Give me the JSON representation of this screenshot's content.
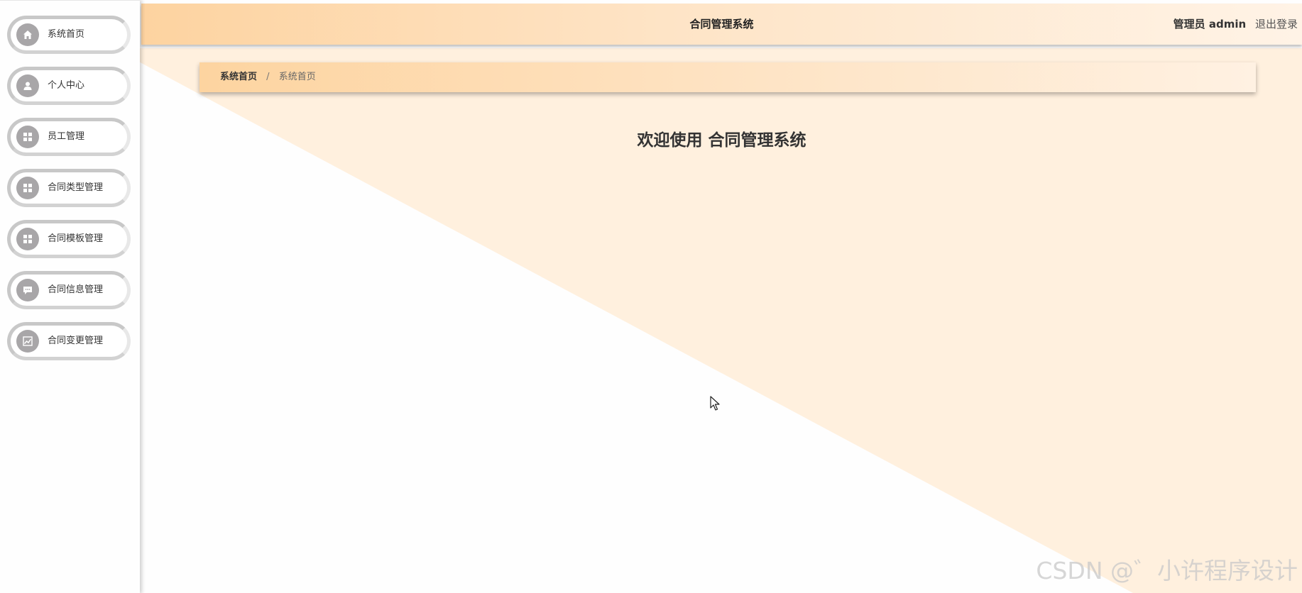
{
  "header": {
    "app_title": "合同管理系统",
    "role_user": "管理员 admin",
    "logout_label": "退出登录"
  },
  "sidebar": {
    "items": [
      {
        "label": "系统首页",
        "icon": "home-icon"
      },
      {
        "label": "个人中心",
        "icon": "user-icon"
      },
      {
        "label": "员工管理",
        "icon": "grid-icon"
      },
      {
        "label": "合同类型管理",
        "icon": "grid-icon"
      },
      {
        "label": "合同模板管理",
        "icon": "grid-icon"
      },
      {
        "label": "合同信息管理",
        "icon": "chat-icon"
      },
      {
        "label": "合同变更管理",
        "icon": "chart-icon"
      }
    ]
  },
  "breadcrumb": {
    "home": "系统首页",
    "separator": "/",
    "current": "系统首页"
  },
  "main": {
    "welcome": "欢迎使用 合同管理系统"
  },
  "watermark": "CSDN @゛小许程序设计",
  "colors": {
    "accent": "#fdd3a0",
    "background_tint": "#fff0de",
    "icon_gray": "#a8a6a8"
  }
}
